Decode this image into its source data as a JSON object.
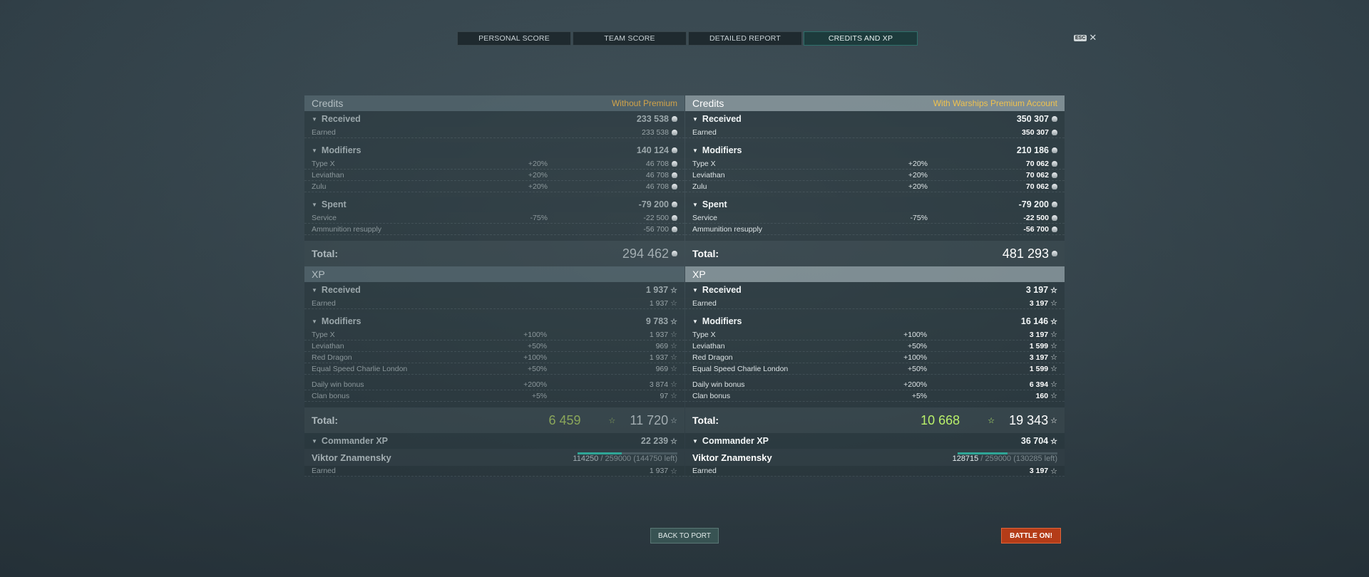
{
  "tabs": [
    "PERSONAL SCORE",
    "TEAM SCORE",
    "DETAILED REPORT",
    "CREDITS AND XP"
  ],
  "esc": {
    "key": "ESC",
    "close": "✕"
  },
  "left": {
    "credits_title": "Credits",
    "credits_sub": "Without Premium",
    "received": {
      "label": "Received",
      "value": "233 538"
    },
    "earned": {
      "label": "Earned",
      "value": "233 538"
    },
    "modifiers": {
      "label": "Modifiers",
      "value": "140 124"
    },
    "mods": [
      {
        "name": "Type X",
        "pct": "+20%",
        "value": "46 708"
      },
      {
        "name": "Leviathan",
        "pct": "+20%",
        "value": "46 708"
      },
      {
        "name": "Zulu",
        "pct": "+20%",
        "value": "46 708"
      }
    ],
    "spent": {
      "label": "Spent",
      "value": "-79 200"
    },
    "spent_items": [
      {
        "name": "Service",
        "pct": "-75%",
        "value": "-22 500"
      },
      {
        "name": "Ammunition resupply",
        "pct": "",
        "value": "-56 700"
      }
    ],
    "credits_total": {
      "label": "Total:",
      "value": "294 462"
    },
    "xp_title": "XP",
    "xp_received": {
      "label": "Received",
      "value": "1 937"
    },
    "xp_earned": {
      "label": "Earned",
      "value": "1 937"
    },
    "xp_modifiers": {
      "label": "Modifiers",
      "value": "9 783"
    },
    "xp_mods": [
      {
        "name": "Type X",
        "pct": "+100%",
        "value": "1 937"
      },
      {
        "name": "Leviathan",
        "pct": "+50%",
        "value": "969"
      },
      {
        "name": "Red Dragon",
        "pct": "+100%",
        "value": "1 937"
      },
      {
        "name": "Equal Speed Charlie London",
        "pct": "+50%",
        "value": "969"
      }
    ],
    "xp_bonus": [
      {
        "name": "Daily win bonus",
        "pct": "+200%",
        "value": "3 874"
      },
      {
        "name": "Clan bonus",
        "pct": "+5%",
        "value": "97"
      }
    ],
    "xp_total": {
      "label": "Total:",
      "green": "6 459",
      "value": "11 720"
    },
    "commander": {
      "label": "Commander XP",
      "value": "22 239"
    },
    "captain": {
      "name": "Viktor Znamensky",
      "current": "114250",
      "rest": " / 259000 (144750 left)",
      "progress": 0.441
    },
    "cut_label": "Earned",
    "cut_value": "1 937"
  },
  "right": {
    "credits_title": "Credits",
    "credits_sub": "With Warships Premium Account",
    "received": {
      "label": "Received",
      "value": "350 307"
    },
    "earned": {
      "label": "Earned",
      "value": "350 307"
    },
    "modifiers": {
      "label": "Modifiers",
      "value": "210 186"
    },
    "mods": [
      {
        "name": "Type X",
        "pct": "+20%",
        "value": "70 062"
      },
      {
        "name": "Leviathan",
        "pct": "+20%",
        "value": "70 062"
      },
      {
        "name": "Zulu",
        "pct": "+20%",
        "value": "70 062"
      }
    ],
    "spent": {
      "label": "Spent",
      "value": "-79 200"
    },
    "spent_items": [
      {
        "name": "Service",
        "pct": "-75%",
        "value": "-22 500"
      },
      {
        "name": "Ammunition resupply",
        "pct": "",
        "value": "-56 700"
      }
    ],
    "credits_total": {
      "label": "Total:",
      "value": "481 293"
    },
    "xp_title": "XP",
    "xp_received": {
      "label": "Received",
      "value": "3 197"
    },
    "xp_earned": {
      "label": "Earned",
      "value": "3 197"
    },
    "xp_modifiers": {
      "label": "Modifiers",
      "value": "16 146"
    },
    "xp_mods": [
      {
        "name": "Type X",
        "pct": "+100%",
        "value": "3 197"
      },
      {
        "name": "Leviathan",
        "pct": "+50%",
        "value": "1 599"
      },
      {
        "name": "Red Dragon",
        "pct": "+100%",
        "value": "3 197"
      },
      {
        "name": "Equal Speed Charlie London",
        "pct": "+50%",
        "value": "1 599"
      }
    ],
    "xp_bonus": [
      {
        "name": "Daily win bonus",
        "pct": "+200%",
        "value": "6 394"
      },
      {
        "name": "Clan bonus",
        "pct": "+5%",
        "value": "160"
      }
    ],
    "xp_total": {
      "label": "Total:",
      "green": "10 668",
      "value": "19 343"
    },
    "commander": {
      "label": "Commander XP",
      "value": "36 704"
    },
    "captain": {
      "name": "Viktor Znamensky",
      "current": "128715",
      "rest": " / 259000 (130285 left)",
      "progress": 0.497
    },
    "cut_label": "Earned",
    "cut_value": "3 197"
  },
  "buttons": {
    "back": "BACK TO PORT",
    "battle": "BATTLE ON!"
  },
  "colors": {
    "accent_teal": "#2fa596",
    "premium_gold": "#f0c24e",
    "battle_red": "#b43c18",
    "xp_green": "#b9f06a"
  }
}
